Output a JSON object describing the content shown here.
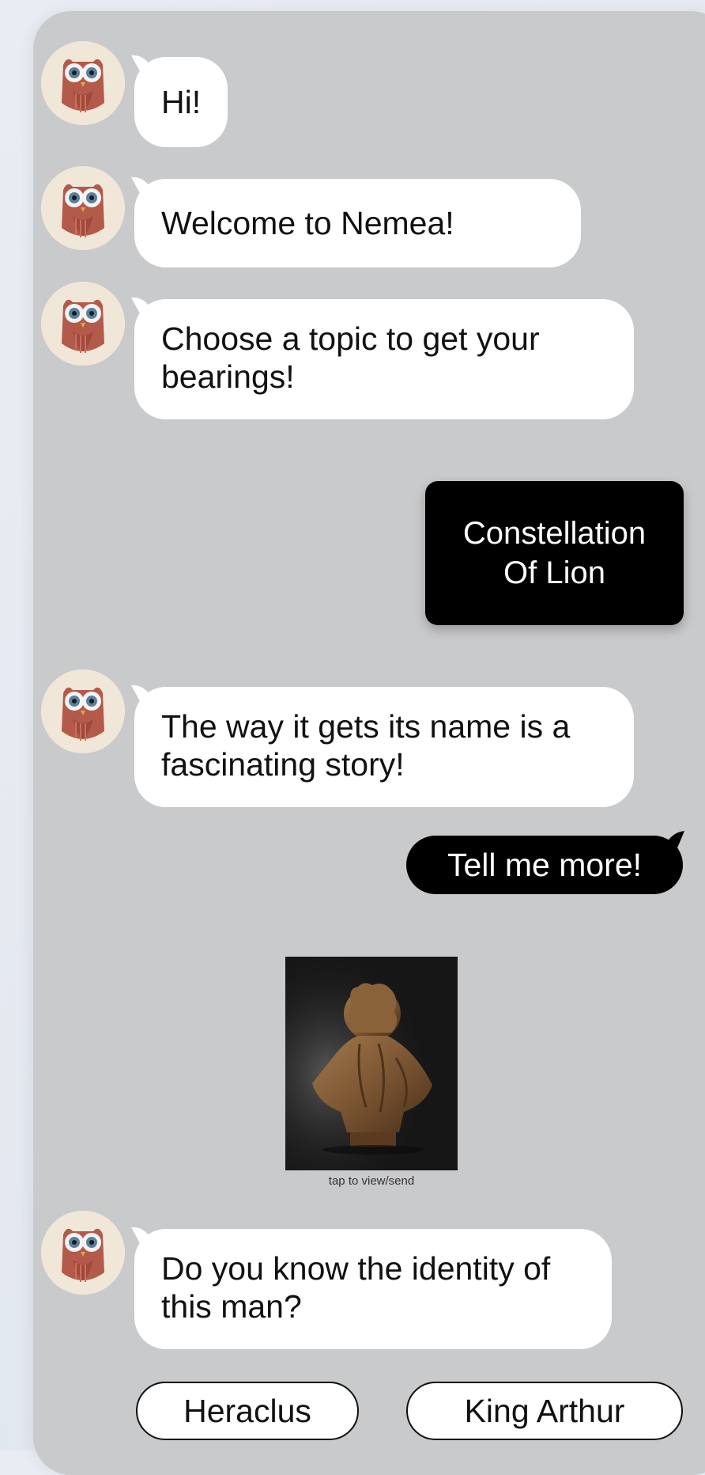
{
  "messages": {
    "m1": "Hi!",
    "m2": "Welcome to Nemea!",
    "m3": "Choose a topic to get your bearings!",
    "m4": "The way it gets its name is a fascinating story!",
    "m5": "Do you know the identity of this man?"
  },
  "user": {
    "topic_line1": "Constellation",
    "topic_line2": "Of Lion",
    "reply": "Tell me more!"
  },
  "image": {
    "icon": "bust-statue-image",
    "caption": "tap to view/send"
  },
  "choices": [
    "Heraclus",
    "King Arthur"
  ],
  "colors": {
    "chat_bg": "#c9cacc",
    "bot_bubble": "#ffffff",
    "user_bubble": "#000000",
    "avatar_bg": "#f1e7d9",
    "owl": "#b35a4a"
  }
}
